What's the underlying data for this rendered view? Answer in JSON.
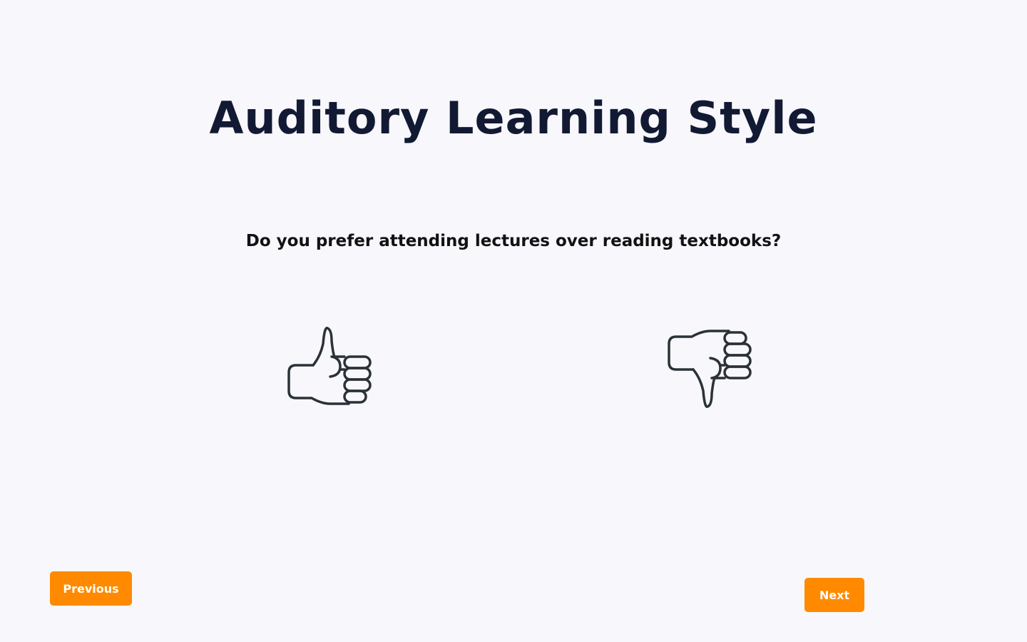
{
  "quiz": {
    "title": "Auditory Learning Style",
    "question": "Do you prefer attending lectures over reading textbooks?"
  },
  "answers": {
    "agree_icon": "thumbs-up-icon",
    "disagree_icon": "thumbs-down-icon"
  },
  "navigation": {
    "previous_label": "Previous",
    "next_label": "Next"
  },
  "colors": {
    "background": "#f7f7fc",
    "accent": "#ff8a00",
    "text": "#121933",
    "icon_stroke": "#2a3238"
  }
}
